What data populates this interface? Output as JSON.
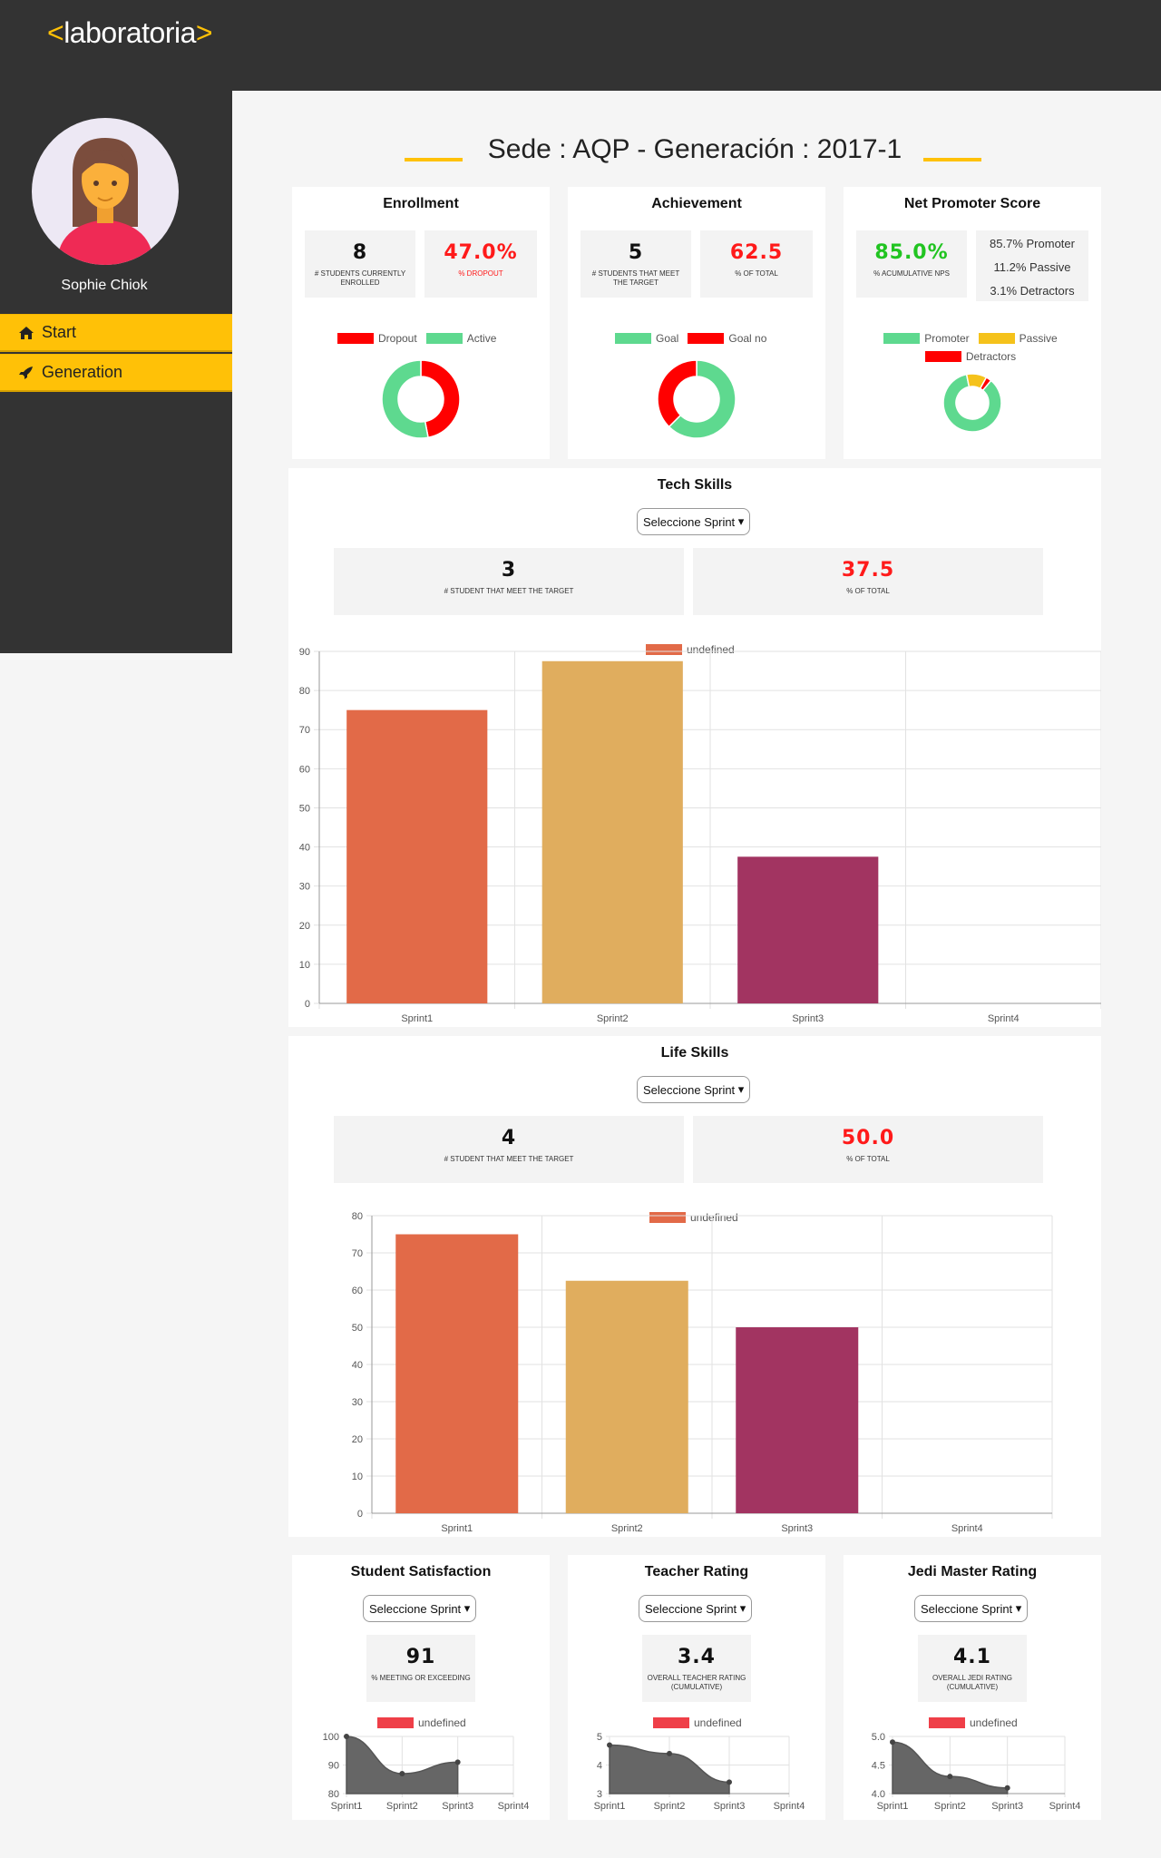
{
  "brand": {
    "logo_open": "<",
    "logo_text": "laboratoria",
    "logo_close": ">",
    "accent": "#ffc107"
  },
  "user": {
    "name": "Sophie Chiok"
  },
  "nav": {
    "items": [
      {
        "label": "Start",
        "icon": "home-icon"
      },
      {
        "label": "Generation",
        "icon": "rocket-icon"
      }
    ]
  },
  "header": {
    "title": "Sede : AQP - Generación : 2017-1"
  },
  "enrollment": {
    "title": "Enrollment",
    "stat1": {
      "value": "8",
      "label": "# STUDENTS CURRENTLY ENROLLED"
    },
    "stat2": {
      "value": "47.0%",
      "label": "% DROPOUT"
    },
    "legend": [
      "Dropout",
      "Active"
    ],
    "donut": {
      "dropout": 47,
      "active": 53
    }
  },
  "achievement": {
    "title": "Achievement",
    "stat1": {
      "value": "5",
      "label": "# STUDENTS THAT MEET THE TARGET"
    },
    "stat2": {
      "value": "62.5",
      "label": "% OF TOTAL"
    },
    "legend": [
      "Goal",
      "Goal no"
    ],
    "donut": {
      "goal": 62.5,
      "goal_no": 37.5
    }
  },
  "nps": {
    "title": "Net Promoter Score",
    "stat1": {
      "value": "85.0%",
      "label": "% ACUMULATIVE NPS"
    },
    "breakdown": [
      "85.7% Promoter",
      "11.2% Passive",
      "3.1% Detractors"
    ],
    "legend": [
      "Promoter",
      "Passive",
      "Detractors"
    ],
    "donut": {
      "promoter": 85.7,
      "passive": 11.2,
      "detractors": 3.1
    }
  },
  "tech": {
    "title": "Tech Skills",
    "select": "Seleccione Sprint",
    "stat1": {
      "value": "3",
      "label": "# STUDENT THAT MEET THE TARGET"
    },
    "stat2": {
      "value": "37.5",
      "label": "% OF TOTAL"
    },
    "legend": "undefined"
  },
  "life": {
    "title": "Life Skills",
    "select": "Seleccione Sprint",
    "stat1": {
      "value": "4",
      "label": "# STUDENT THAT MEET THE TARGET"
    },
    "stat2": {
      "value": "50.0",
      "label": "% OF TOTAL"
    },
    "legend": "undefined"
  },
  "satisfaction": {
    "title": "Student Satisfaction",
    "select": "Seleccione Sprint",
    "stat": {
      "value": "91",
      "label": "% MEETING OR EXCEEDING"
    },
    "legend": "undefined"
  },
  "teacher": {
    "title": "Teacher Rating",
    "select": "Seleccione Sprint",
    "stat": {
      "value": "3.4",
      "label": "OVERALL TEACHER RATING (CUMULATIVE)"
    },
    "legend": "undefined"
  },
  "jedi": {
    "title": "Jedi Master Rating",
    "select": "Seleccione Sprint",
    "stat": {
      "value": "4.1",
      "label": "OVERALL JEDI RATING (CUMULATIVE)"
    },
    "legend": "undefined"
  },
  "colors": {
    "red": "#ff0000",
    "green": "#5ed98f",
    "yellow": "#f5c21b",
    "bar1": "#e26a48",
    "bar2": "#e0ad5e",
    "bar3": "#a23461",
    "line_fill": "#666666",
    "legend_red": "#ef3f48"
  },
  "chart_data": [
    {
      "id": "tech",
      "type": "bar",
      "categories": [
        "Sprint1",
        "Sprint2",
        "Sprint3",
        "Sprint4"
      ],
      "values": [
        75,
        87.5,
        37.5,
        null
      ],
      "ylim": [
        0,
        90
      ],
      "yticks": [
        0,
        10,
        20,
        30,
        40,
        50,
        60,
        70,
        80,
        90
      ],
      "legend": "undefined"
    },
    {
      "id": "life",
      "type": "bar",
      "categories": [
        "Sprint1",
        "Sprint2",
        "Sprint3",
        "Sprint4"
      ],
      "values": [
        75,
        62.5,
        50,
        null
      ],
      "ylim": [
        0,
        80
      ],
      "yticks": [
        0,
        10,
        20,
        30,
        40,
        50,
        60,
        70,
        80
      ],
      "legend": "undefined"
    },
    {
      "id": "satisfaction",
      "type": "area",
      "categories": [
        "Sprint1",
        "Sprint2",
        "Sprint3",
        "Sprint4"
      ],
      "values": [
        100,
        87,
        91,
        null
      ],
      "ylim": [
        80,
        100
      ],
      "yticks": [
        80,
        90,
        100
      ],
      "legend": "undefined"
    },
    {
      "id": "teacher",
      "type": "area",
      "categories": [
        "Sprint1",
        "Sprint2",
        "Sprint3",
        "Sprint4"
      ],
      "values": [
        4.7,
        4.4,
        3.4,
        null
      ],
      "ylim": [
        3,
        5
      ],
      "yticks": [
        3,
        4,
        5
      ],
      "legend": "undefined"
    },
    {
      "id": "jedi",
      "type": "area",
      "categories": [
        "Sprint1",
        "Sprint2",
        "Sprint3",
        "Sprint4"
      ],
      "values": [
        4.9,
        4.3,
        4.1,
        null
      ],
      "ylim": [
        4.0,
        5.0
      ],
      "yticks": [
        "4.0",
        "4.5",
        "5.0"
      ],
      "legend": "undefined"
    }
  ]
}
